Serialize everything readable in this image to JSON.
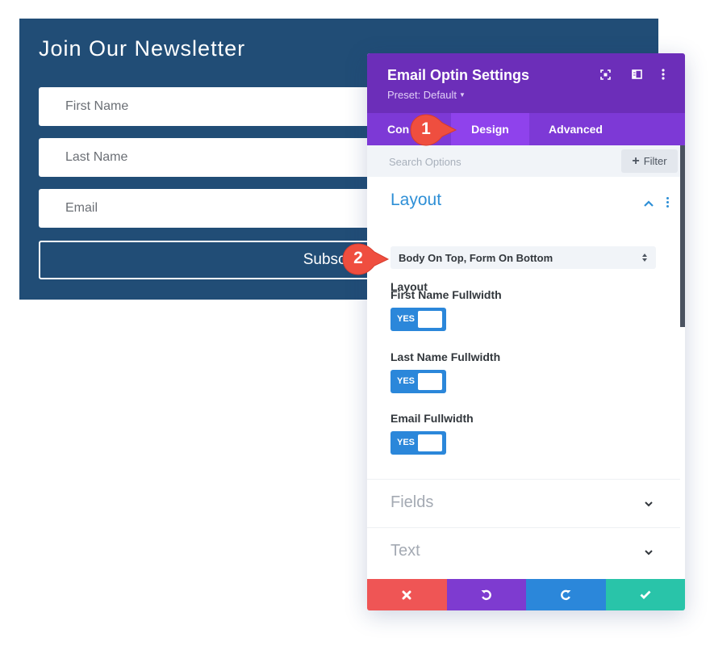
{
  "newsletter": {
    "title": "Join Our Newsletter",
    "fields": [
      {
        "placeholder": "First Name"
      },
      {
        "placeholder": "Last Name"
      },
      {
        "placeholder": "Email"
      }
    ],
    "submit_label": "Subscribe"
  },
  "modal": {
    "title": "Email Optin Settings",
    "preset_label": "Preset: Default",
    "header_icons": [
      "focus-mode-icon",
      "split-view-icon",
      "more-options-icon"
    ],
    "tabs": [
      {
        "label": "Content",
        "visible_label": "Con",
        "active": false
      },
      {
        "label": "Design",
        "active": true
      },
      {
        "label": "Advanced",
        "active": false
      }
    ],
    "search": {
      "placeholder": "Search Options"
    },
    "filter_label": "Filter",
    "sections": {
      "layout": {
        "title": "Layout",
        "expanded": true,
        "layout_field": {
          "label": "Layout",
          "value": "Body On Top, Form On Bottom"
        },
        "toggles": [
          {
            "label": "First Name Fullwidth",
            "value": "YES"
          },
          {
            "label": "Last Name Fullwidth",
            "value": "YES"
          },
          {
            "label": "Email Fullwidth",
            "value": "YES"
          }
        ]
      },
      "fields": {
        "title": "Fields",
        "expanded": false
      },
      "text": {
        "title": "Text",
        "expanded": false
      }
    },
    "footer": [
      "cancel",
      "undo",
      "redo",
      "save"
    ]
  },
  "callouts": [
    {
      "number": "1"
    },
    {
      "number": "2"
    }
  ],
  "colors": {
    "newsletter_bg": "#214d76",
    "header_purple": "#6c2eb9",
    "tab_purple": "#7d39d6",
    "active_tab": "#8f42ec",
    "accent_blue": "#2b87da",
    "cancel_red": "#ef5555",
    "save_green": "#29c4a9",
    "callout_red": "#ef4e3f"
  }
}
